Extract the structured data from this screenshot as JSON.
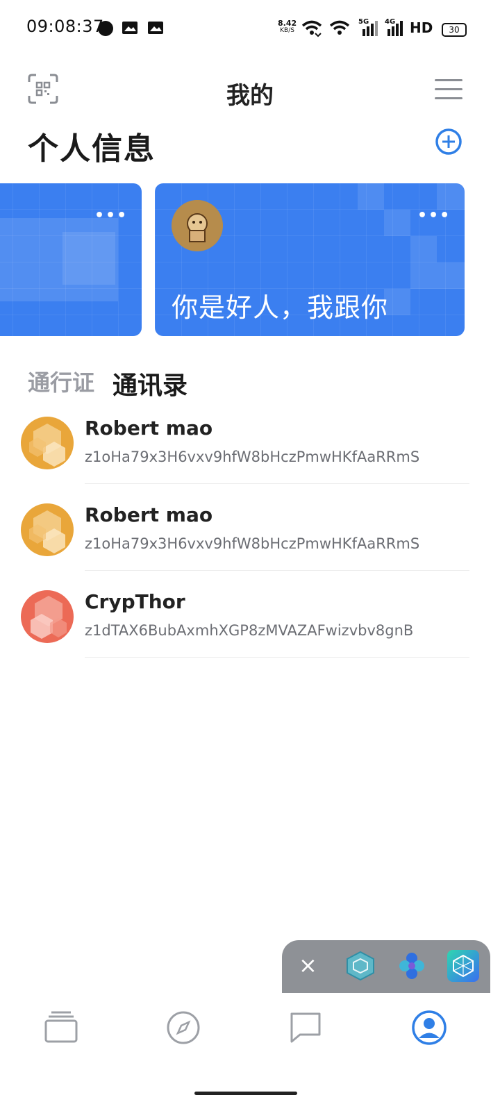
{
  "status_bar": {
    "time": "09:08:37",
    "speed_value": "8.42",
    "speed_unit": "KB/S",
    "battery": "30",
    "net1": "5G",
    "net2": "4G",
    "hd": "HD"
  },
  "header": {
    "title": "我的",
    "scan_icon": "qr-scan-icon",
    "menu_icon": "hamburger-menu-icon"
  },
  "personal": {
    "section_title": "个人信息",
    "add_icon": "plus-circle-icon",
    "cards": [
      {
        "text": "",
        "more": "•••"
      },
      {
        "text": "你是好人，我跟你",
        "more": "•••"
      }
    ]
  },
  "tabs": [
    {
      "label": "通行证",
      "active": false
    },
    {
      "label": "通讯录",
      "active": true
    }
  ],
  "contacts": [
    {
      "name": "Robert mao",
      "address": "z1oHa79x3H6vxv9hfW8bHczPmwHKfAaRRmS",
      "avatar_color": "#e9a63a"
    },
    {
      "name": "Robert mao",
      "address": "z1oHa79x3H6vxv9hfW8bHczPmwHKfAaRRmS",
      "avatar_color": "#e9a63a"
    },
    {
      "name": "CrypThor",
      "address": "z1dTAX6BubAxmhXGP8zMVAZAFwizvbv8gnB",
      "avatar_color": "#ec6a56"
    }
  ],
  "floating_bar": {
    "close": "×",
    "apps": [
      "cube-app-icon",
      "flower-app-icon",
      "cube-gradient-app-icon"
    ]
  },
  "bottom_nav": {
    "items": [
      "cards-icon",
      "compass-icon",
      "chat-icon",
      "profile-icon"
    ],
    "active_index": 3,
    "active_color": "#2f7fe6",
    "inactive_color": "#9da0a6"
  },
  "colors": {
    "accent": "#2f7fe6",
    "card_blue": "#3b7ff0"
  }
}
